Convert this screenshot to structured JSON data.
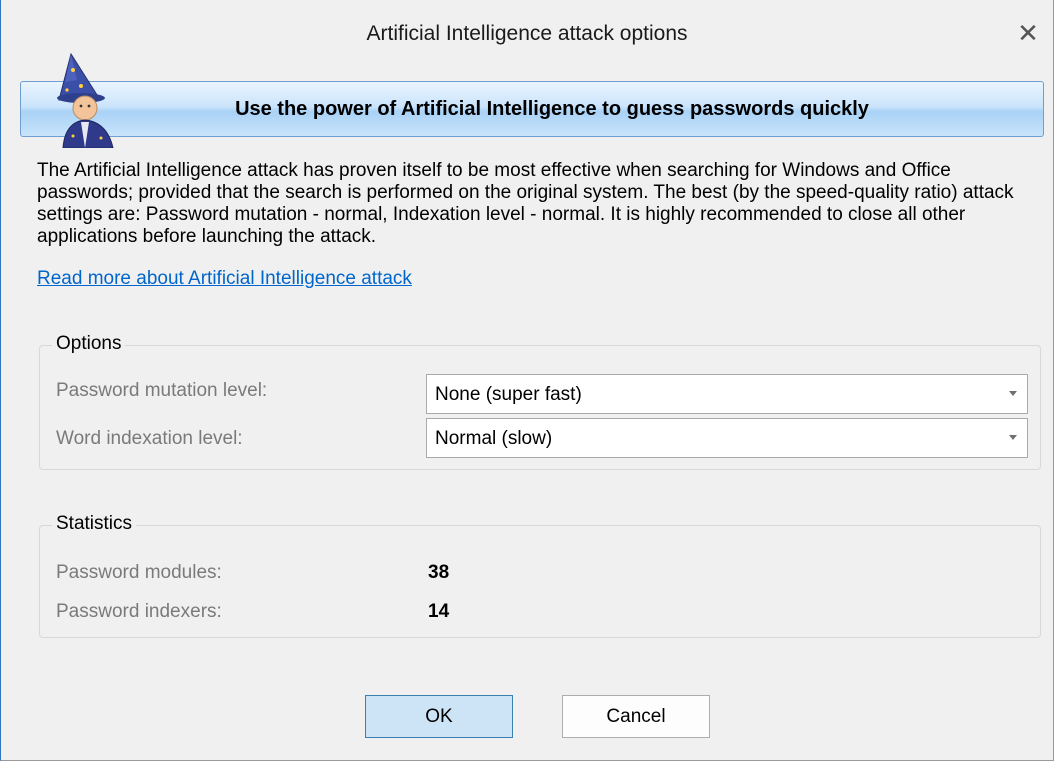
{
  "window": {
    "title": "Artificial Intelligence attack options",
    "close_glyph": "✕"
  },
  "banner": {
    "text": "Use the power of Artificial Intelligence to guess passwords quickly",
    "icon": "wizard-icon"
  },
  "description": "The Artificial Intelligence attack has proven itself to be most effective when searching for Windows and Office passwords; provided that the search is performed on the original system. The best (by the speed-quality ratio) attack settings are: Password mutation - normal, Indexation level - normal. It is highly recommended to close all other applications before launching the attack.",
  "read_more_link": "Read more about Artificial Intelligence attack",
  "options": {
    "label": "Options",
    "mutation_label": "Password mutation level:",
    "mutation_value": "None (super fast)",
    "indexation_label": "Word indexation level:",
    "indexation_value": "Normal (slow)"
  },
  "statistics": {
    "label": "Statistics",
    "modules_label": "Password modules:",
    "modules_value": "38",
    "indexers_label": "Password indexers:",
    "indexers_value": "14"
  },
  "buttons": {
    "ok": "OK",
    "cancel": "Cancel"
  },
  "colors": {
    "link": "#0066cc",
    "banner_border": "#6f9fd0",
    "ok_border": "#3c7fb1"
  }
}
